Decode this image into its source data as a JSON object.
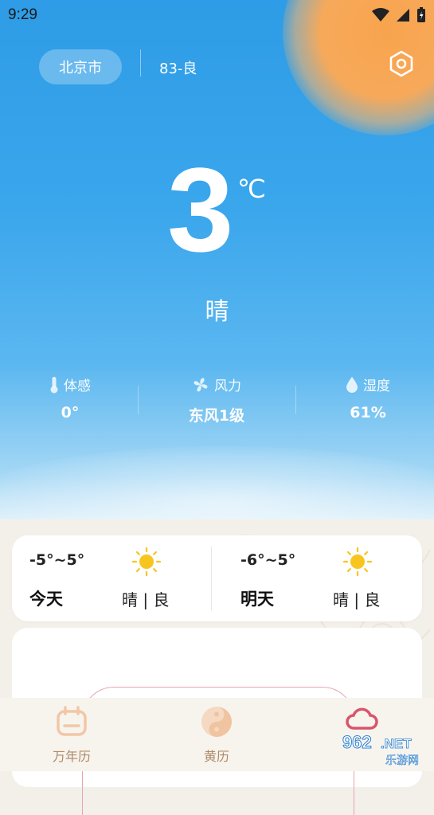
{
  "status_bar": {
    "time": "9:29"
  },
  "header": {
    "city": "北京市",
    "aqi": "83-良"
  },
  "current": {
    "temperature": "3",
    "unit": "℃",
    "condition": "晴"
  },
  "stats": [
    {
      "icon": "thermometer-icon",
      "label": "体感",
      "value": "0°"
    },
    {
      "icon": "fan-icon",
      "label": "风力",
      "value": "东风1级"
    },
    {
      "icon": "droplet-icon",
      "label": "湿度",
      "value": "61%"
    }
  ],
  "forecast": [
    {
      "range": "-5°~5°",
      "day": "今天",
      "condition": "晴 | 良",
      "icon": "sun-icon"
    },
    {
      "range": "-6°~5°",
      "day": "明天",
      "condition": "晴 | 良",
      "icon": "sun-icon"
    }
  ],
  "tabs": [
    {
      "label": "万年历",
      "icon": "calendar-icon"
    },
    {
      "label": "黄历",
      "icon": "yin-yang-icon"
    },
    {
      "label": "",
      "icon": "weather-cloud-icon"
    }
  ],
  "watermark": {
    "brand": "962.NET",
    "site": "乐游网"
  },
  "colors": {
    "sky_top": "#2e9ce6",
    "sun": "#f8a44e",
    "tab_active": "#b08a66",
    "accent_pink": "#e8a4ae"
  }
}
